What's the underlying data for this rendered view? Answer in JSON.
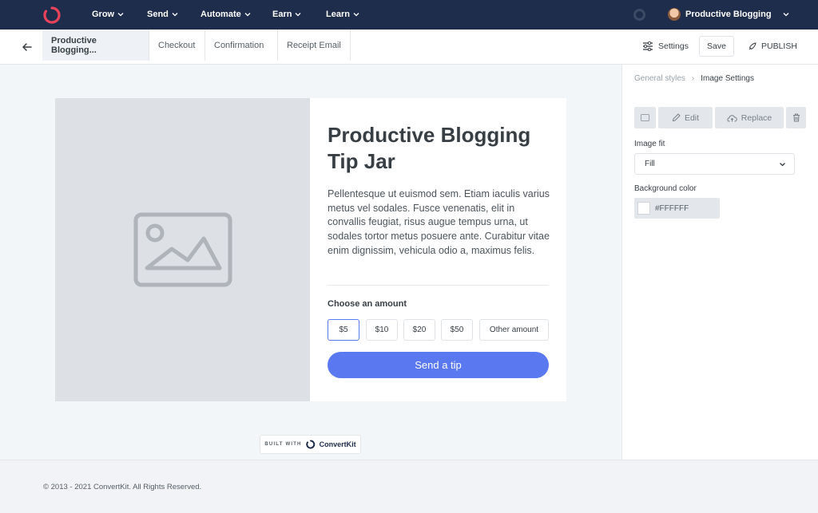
{
  "topnav": {
    "items": [
      {
        "label": "Grow"
      },
      {
        "label": "Send"
      },
      {
        "label": "Automate"
      },
      {
        "label": "Earn"
      },
      {
        "label": "Learn"
      }
    ],
    "account_name": "Productive Blogging",
    "colors": {
      "background": "#1f2d4d",
      "logo": "#e8435a"
    }
  },
  "tabbar": {
    "tabs": [
      {
        "label": "Productive Blogging..."
      },
      {
        "label": "Checkout"
      },
      {
        "label": "Confirmation"
      },
      {
        "label": "Receipt Email"
      }
    ],
    "settings_label": "Settings",
    "save_label": "Save",
    "publish_label": "PUBLISH"
  },
  "card": {
    "title": "Productive Blogging Tip Jar",
    "body": "Pellentesque ut euismod sem. Etiam iaculis varius metus vel sodales. Fusce venenatis, elit in convallis feugiat, risus augue tempus urna, ut sodales tortor metus posuere ante. Curabitur vitae enim dignissim, vehicula odio a, maximus felis.",
    "amount_label": "Choose an amount",
    "amounts": [
      {
        "label": "$5",
        "selected": true
      },
      {
        "label": "$10"
      },
      {
        "label": "$20"
      },
      {
        "label": "$50"
      },
      {
        "label": "Other amount"
      }
    ],
    "tip_button": "Send a tip",
    "accent": "#5a79f0"
  },
  "badge": {
    "built_with": "BUILT WITH",
    "brand": "ConvertKit"
  },
  "panel": {
    "breadcrumb_parent": "General styles",
    "breadcrumb_current": "Image Settings",
    "edit_label": "Edit",
    "replace_label": "Replace",
    "image_fit_label": "Image fit",
    "image_fit_value": "Fill",
    "bg_color_label": "Background color",
    "bg_color_value": "#FFFFFF"
  },
  "footer": {
    "copyright": "© 2013 - 2021 ConvertKit. All Rights Reserved."
  }
}
